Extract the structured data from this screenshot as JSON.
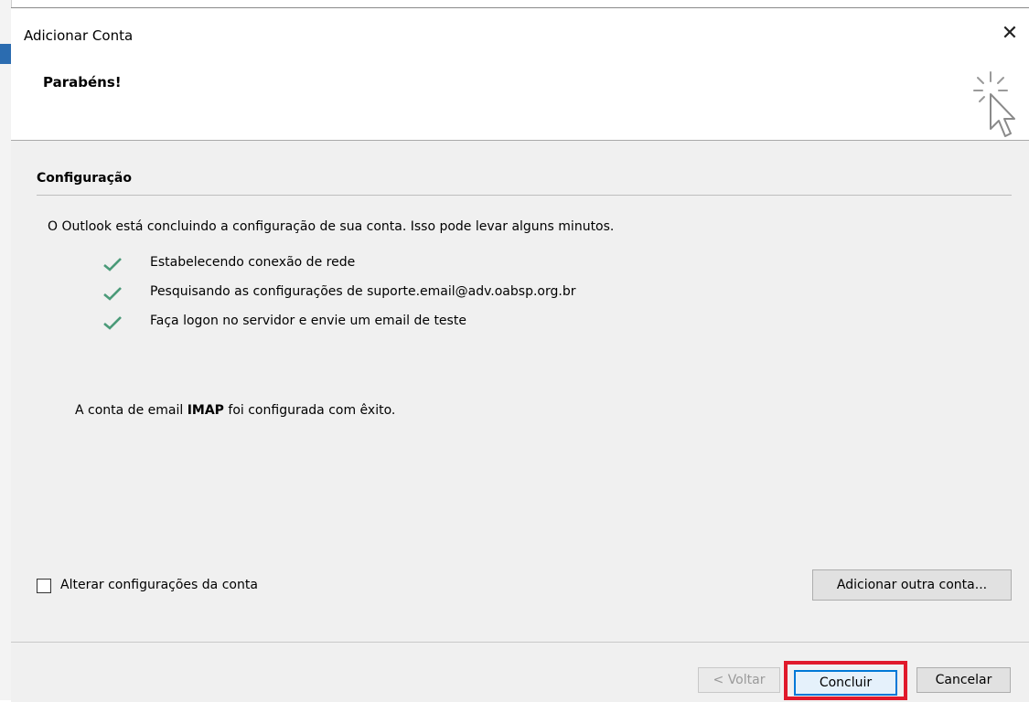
{
  "window": {
    "title": "Adicionar Conta",
    "close_icon": "close-icon"
  },
  "header": {
    "title": "Parabéns!",
    "icon": "click-cursor-icon"
  },
  "section": {
    "title": "Configuração",
    "intro": "O Outlook está concluindo a configuração de sua conta. Isso pode levar alguns minutos.",
    "steps": [
      {
        "label": "Estabelecendo conexão de rede",
        "status": "done"
      },
      {
        "label": "Pesquisando as configurações de suporte.email@adv.oabsp.org.br",
        "status": "done"
      },
      {
        "label": "Faça logon no servidor e envie um email de teste",
        "status": "done"
      }
    ],
    "success_prefix": "A conta de email ",
    "success_bold": "IMAP",
    "success_suffix": " foi configurada com êxito."
  },
  "options": {
    "change_settings_label": "Alterar configurações da conta",
    "change_settings_checked": false,
    "add_account_label": "Adicionar outra conta..."
  },
  "footer": {
    "back_label": "< Voltar",
    "finish_label": "Concluir",
    "cancel_label": "Cancelar"
  },
  "colors": {
    "check": "#4a9a78",
    "highlight": "#e0192b",
    "focus": "#0078d7"
  }
}
